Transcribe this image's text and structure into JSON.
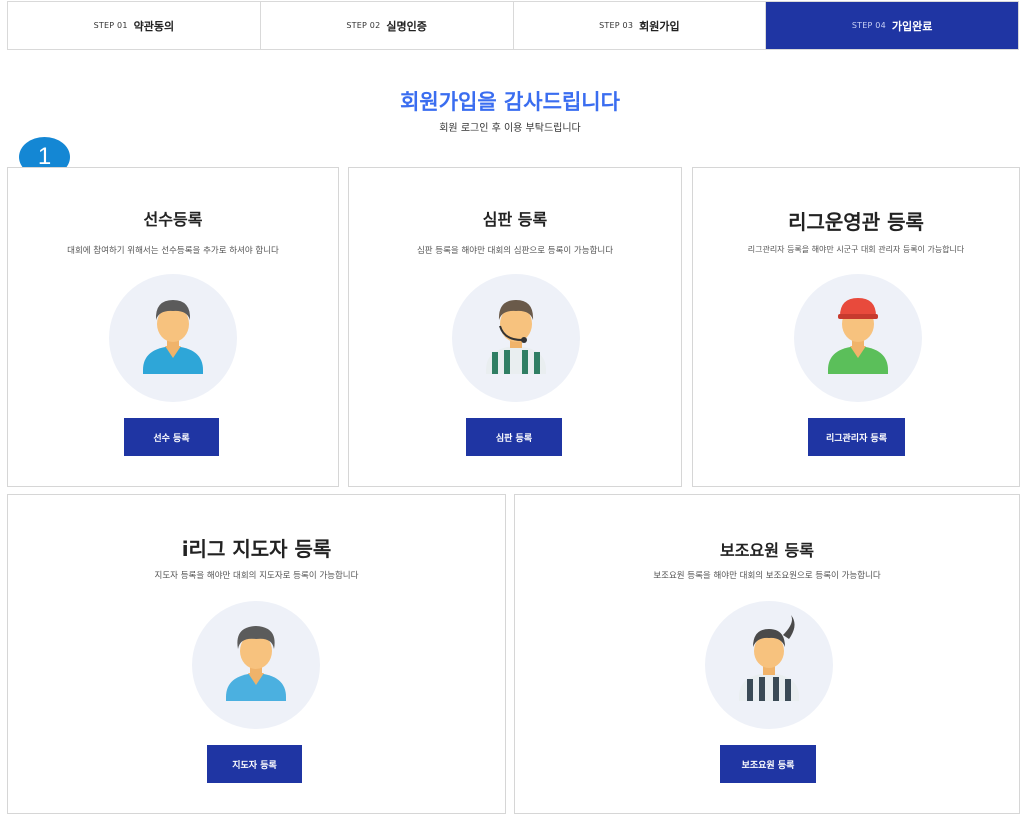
{
  "steps": [
    {
      "num": "STEP 01",
      "name": "약관동의"
    },
    {
      "num": "STEP 02",
      "name": "실명인증"
    },
    {
      "num": "STEP 03",
      "name": "회원가입"
    },
    {
      "num": "STEP 04",
      "name": "가입완료"
    }
  ],
  "header": {
    "title": "회원가입을 감사드립니다",
    "subtitle": "회원 로그인 후 이용 부탁드립니다",
    "badge": "1"
  },
  "cards": [
    {
      "title": "선수등록",
      "desc": "대회에 참여하기 위해서는 선수등록을 추가로 하셔야 합니다",
      "button": "선수 등록",
      "icon": "player-avatar-icon"
    },
    {
      "title": "심판 등록",
      "desc": "심판 등록을 해야만 대회의 심판으로 등록이 가능합니다",
      "button": "심판 등록",
      "icon": "referee-avatar-icon"
    },
    {
      "title": "리그운영관 등록",
      "desc": "리그관리자 등록을 해야만 시군구 대회 관리자 등록이 가능합니다",
      "button": "리그관리자 등록",
      "icon": "league-manager-avatar-icon"
    },
    {
      "title": "i리그 지도자 등록",
      "desc": "지도자 등록을 해야만 대회의 지도자로 등록이 가능합니다",
      "button": "지도자 등록",
      "icon": "coach-avatar-icon"
    },
    {
      "title": "보조요원 등록",
      "desc": "보조요원 등록을 해야만 대회의 보조요원으로 등록이 가능합니다",
      "button": "보조요원 등록",
      "icon": "assistant-avatar-icon"
    }
  ],
  "colors": {
    "accent": "#1f35a3",
    "title": "#3a6df0",
    "badge": "#1487d4",
    "circle_bg": "#eef1f8"
  }
}
